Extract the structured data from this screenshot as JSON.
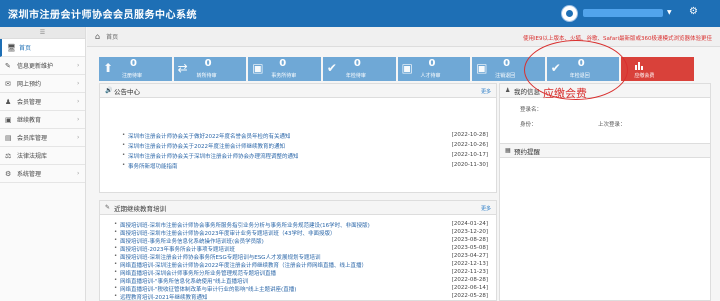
{
  "header": {
    "title": "深圳市注册会计师协会会员服务中心系统",
    "caret": "▼",
    "gear": "⚙"
  },
  "sidebar": {
    "collapse": "☰",
    "items": [
      {
        "icon": "🖥",
        "label": "首页",
        "chevron": ""
      },
      {
        "icon": "✎",
        "label": "信息更新维护",
        "chevron": "›"
      },
      {
        "icon": "✉",
        "label": "网上预约",
        "chevron": "›"
      },
      {
        "icon": "♟",
        "label": "会员管理",
        "chevron": "›"
      },
      {
        "icon": "▣",
        "label": "继续教育",
        "chevron": "›"
      },
      {
        "icon": "▤",
        "label": "会员库管理",
        "chevron": "›"
      },
      {
        "icon": "⚖",
        "label": "法律法规库",
        "chevron": ""
      },
      {
        "icon": "⚙",
        "label": "系统管理",
        "chevron": "›"
      }
    ]
  },
  "breadcrumb": {
    "home_icon": "⌂",
    "current": "首页",
    "notice": "使用IE9以上版本、火狐、谷歌、Safari最新版或360极速模式浏览器体验更佳"
  },
  "stats": [
    {
      "icon": "⬆",
      "value": "0",
      "label": "注册待审"
    },
    {
      "icon": "⇄",
      "value": "0",
      "label": "转所待审"
    },
    {
      "icon": "▣",
      "value": "0",
      "label": "事务所待审"
    },
    {
      "icon": "✔",
      "value": "0",
      "label": "年检待审"
    },
    {
      "icon": "▣",
      "value": "0",
      "label": "人才待审"
    },
    {
      "icon": "▣",
      "value": "0",
      "label": "注销退回"
    },
    {
      "icon": "✔",
      "value": "0",
      "label": "年检退回"
    },
    {
      "icon": "",
      "value": "",
      "label": "应缴会费"
    }
  ],
  "announcements": {
    "title": "公告中心",
    "more": "更多",
    "items": [
      {
        "title": "深圳市注册会计师协会关于做好2022年度名誉会员年检的有关通知",
        "date": "[2022-10-28]"
      },
      {
        "title": "深圳市注册会计师协会关于2022年度注册会计师继续教育的通知",
        "date": "[2022-10-26]"
      },
      {
        "title": "深圳市注册会计师协会关于深圳市注册会计师协会办理流程调整的通知",
        "date": "[2022-10-17]"
      },
      {
        "title": "事务所新增功能指南",
        "date": "[2020-11-30]"
      }
    ]
  },
  "training": {
    "title": "近期继续教育培训",
    "more": "更多",
    "items": [
      {
        "title": "面授培训班-深圳市注册会计师协会事务所服务指引业务分析与事务所业务规范建设(16学时、非面授版)",
        "date": "[2024-01-24]"
      },
      {
        "title": "面授培训班-深圳市注册会计师协会2023年度审计业务专题培训班（43学时、非面授版）",
        "date": "[2023-12-20]"
      },
      {
        "title": "面授培训班-事务所业务信息化系统操作培训班(会员学员版)",
        "date": "[2023-08-28]"
      },
      {
        "title": "面授培训班-2023年事务所会计事项专题培训班",
        "date": "[2023-05-08]"
      },
      {
        "title": "面授培训班-深圳注册会计师协会事务所ESG专题培训与ESG人才发展规划专题培训",
        "date": "[2023-04-27]"
      },
      {
        "title": "网络直播培训-深圳注册会计师协会2022年度注册会计师继续教育（注册会计师网络直播、线上直播）",
        "date": "[2022-12-13]"
      },
      {
        "title": "网络直播培训-深圳会计师事务所分所业务管理规范专题培训直播",
        "date": "[2022-11-23]"
      },
      {
        "title": "网络直播培训-\"事务所信息化系统使用\"线上直播培训",
        "date": "[2022-08-28]"
      },
      {
        "title": "网络直播培训-\"税收征管体制改革与审计行业的影响\"线上主题讲座(直播)",
        "date": "[2022-06-14]"
      },
      {
        "title": "远程教育培训-2021年继续教育通知",
        "date": "[2022-05-28]"
      }
    ]
  },
  "member_info": {
    "title": "我的信息",
    "reg_no_label": "登录名：",
    "id_label": "身份：",
    "last_login_label": "上次登录："
  },
  "reminder": {
    "title": "预约提醒"
  },
  "annotation": "应缴会费",
  "colors": {
    "header": "#1e6fb5",
    "stat": "#6fa8d6",
    "alert": "#d9413a",
    "link": "#2a66a8"
  }
}
